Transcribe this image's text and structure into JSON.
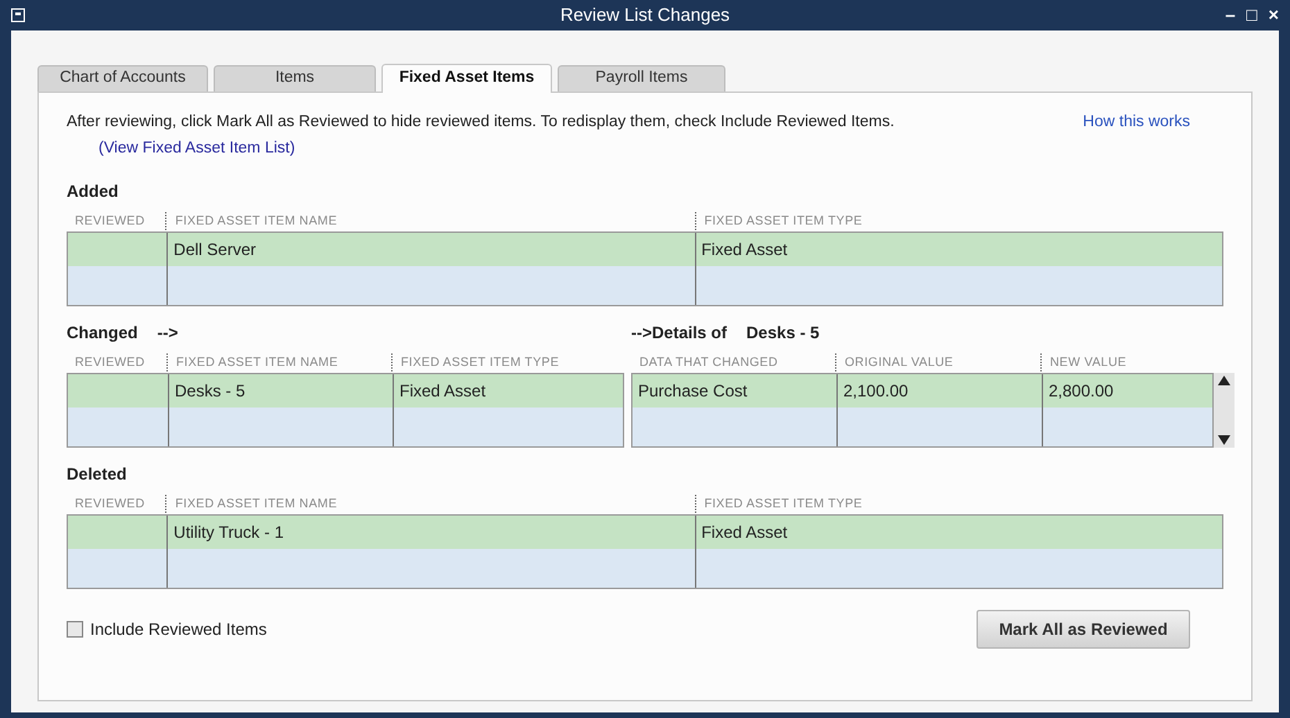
{
  "window": {
    "title": "Review List Changes",
    "controls": [
      "–",
      "□",
      "×"
    ]
  },
  "tabs": [
    {
      "label": "Chart of Accounts",
      "selected": false
    },
    {
      "label": "Items",
      "selected": false
    },
    {
      "label": "Fixed Asset Items",
      "selected": true
    },
    {
      "label": "Payroll Items",
      "selected": false
    }
  ],
  "instructions": "After reviewing, click Mark All as Reviewed to hide reviewed items. To redisplay them, check Include Reviewed Items.",
  "help_link": "How this works",
  "list_link": "(View Fixed Asset Item List)",
  "added": {
    "heading": "Added",
    "columns": [
      "REVIEWED",
      "FIXED ASSET ITEM NAME",
      "FIXED ASSET ITEM TYPE"
    ],
    "rows": [
      {
        "cells": [
          "",
          "Dell Server",
          "Fixed Asset"
        ]
      }
    ]
  },
  "changed": {
    "heading": "Changed",
    "arrow": "-->",
    "columns": [
      "REVIEWED",
      "FIXED ASSET ITEM NAME",
      "FIXED ASSET ITEM TYPE"
    ],
    "rows": [
      {
        "cells": [
          "",
          "Desks - 5",
          "Fixed Asset"
        ]
      }
    ]
  },
  "details": {
    "heading": "-->Details of",
    "item": "Desks - 5",
    "columns": [
      "DATA THAT CHANGED",
      "ORIGINAL VALUE",
      "NEW VALUE"
    ],
    "rows": [
      {
        "cells": [
          "Purchase Cost",
          "2,100.00",
          "2,800.00"
        ]
      }
    ]
  },
  "deleted": {
    "heading": "Deleted",
    "columns": [
      "REVIEWED",
      "FIXED ASSET ITEM NAME",
      "FIXED ASSET ITEM TYPE"
    ],
    "rows": [
      {
        "cells": [
          "",
          "Utility Truck - 1",
          "Fixed Asset"
        ]
      }
    ]
  },
  "include_reviewed": {
    "label": "Include Reviewed Items",
    "checked": false
  },
  "buttons": [
    "Mark All as Reviewed"
  ]
}
